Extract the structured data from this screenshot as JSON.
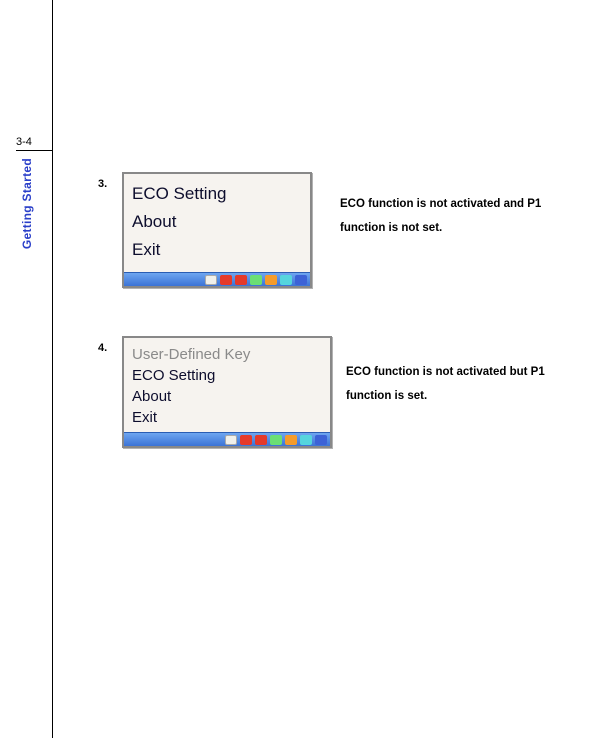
{
  "page_number": "3-4",
  "side_tab": "Getting Started",
  "step3": {
    "num": "3.",
    "menu": [
      "ECO Setting",
      "About",
      "Exit"
    ],
    "caption_line1": "ECO function is not activated and P1",
    "caption_line2": "function is not set."
  },
  "step4": {
    "num": "4.",
    "menu": [
      "User-Defined Key",
      "ECO Setting",
      "About",
      "Exit"
    ],
    "caption_line1": "ECO function is not activated but P1",
    "caption_line2": "function is set."
  }
}
